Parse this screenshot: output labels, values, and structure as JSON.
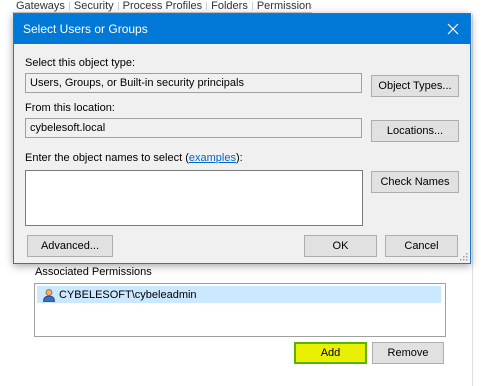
{
  "background": {
    "tabs": [
      "Gateways",
      "Security",
      "Process Profiles",
      "Folders",
      "Permissions"
    ],
    "associated_permissions_label": "Associated Permissions",
    "users": [
      {
        "name": "CYBELESOFT\\cybeleadmin",
        "icon": "user-icon"
      }
    ],
    "add_label": "Add",
    "remove_label": "Remove",
    "colors": {
      "add_highlight": "#e8ef00",
      "add_border": "#56b500",
      "selection": "#cce8ff"
    }
  },
  "dialog": {
    "title": "Select Users or Groups",
    "object_type_label": "Select this object type:",
    "object_type_value": "Users, Groups, or Built-in security principals",
    "object_types_button": "Object Types...",
    "location_label": "From this location:",
    "location_value": "cybelesoft.local",
    "locations_button": "Locations...",
    "names_label_prefix": "Enter the object names to select (",
    "names_label_link": "examples",
    "names_label_suffix": "):",
    "names_value": "",
    "check_names_button": "Check Names",
    "advanced_button": "Advanced...",
    "ok_button": "OK",
    "cancel_button": "Cancel",
    "colors": {
      "titlebar": "#0078d7",
      "link": "#0066cc"
    }
  }
}
